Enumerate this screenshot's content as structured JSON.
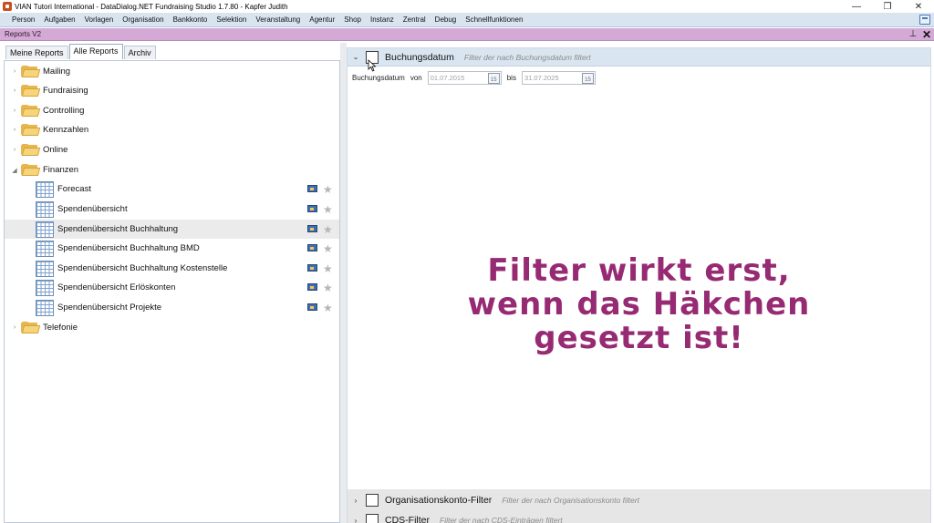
{
  "window": {
    "title": "VIAN Tutori International - DataDialog.NET Fundraising Studio 1.7.80 - Kapfer Judith",
    "controls": [
      "—",
      "❐",
      "✕"
    ]
  },
  "menu": [
    "Person",
    "Aufgaben",
    "Vorlagen",
    "Organisation",
    "Bankkonto",
    "Selektion",
    "Veranstaltung",
    "Agentur",
    "Shop",
    "Instanz",
    "Zentral",
    "Debug",
    "Schnellfunktionen"
  ],
  "document": {
    "title": "Reports V2",
    "pin": "⊥",
    "close": "✕"
  },
  "tabs": [
    "Meine Reports",
    "Alle Reports",
    "Archiv"
  ],
  "active_tab": "Alle Reports",
  "tree": {
    "folders_top": [
      "Mailing",
      "Fundraising",
      "Controlling",
      "Kennzahlen",
      "Online"
    ],
    "open_folder": "Finanzen",
    "reports": [
      "Forecast",
      "Spendenübersicht",
      "Spendenübersicht Buchhaltung",
      "Spendenübersicht Buchhaltung BMD",
      "Spendenübersicht Buchhaltung Kostenstelle",
      "Spendenübersicht Erlöskonten",
      "Spendenübersicht Projekte"
    ],
    "selected_report": "Spendenübersicht Buchhaltung",
    "folders_bottom": [
      "Telefonie"
    ],
    "collapsed_glyph": "›",
    "expanded_glyph": "◢",
    "star_glyph": "★"
  },
  "filters": {
    "open": {
      "name": "Buchungsdatum",
      "description": "Filter der nach Buchungsdatum filtert",
      "checked": false,
      "row_label": "Buchungsdatum",
      "from_label": "von",
      "from_value": "01.07.2015",
      "to_label": "bis",
      "to_value": "31.07.2025",
      "calendar_glyph": "15"
    },
    "collapsed": [
      {
        "name": "Organisationskonto-Filter",
        "description": "Filter der nach Organisationskonto filtert",
        "checked": false
      },
      {
        "name": "CDS-Filter",
        "description": "Filter der nach CDS-Einträgen filtert",
        "checked": false
      }
    ],
    "open_chevron": "⌄",
    "closed_chevron": "›"
  },
  "annotation": {
    "line1": "Filter wirkt erst,",
    "line2": "wenn das Häkchen",
    "line3": "gesetzt ist!",
    "color": "#962a73"
  }
}
